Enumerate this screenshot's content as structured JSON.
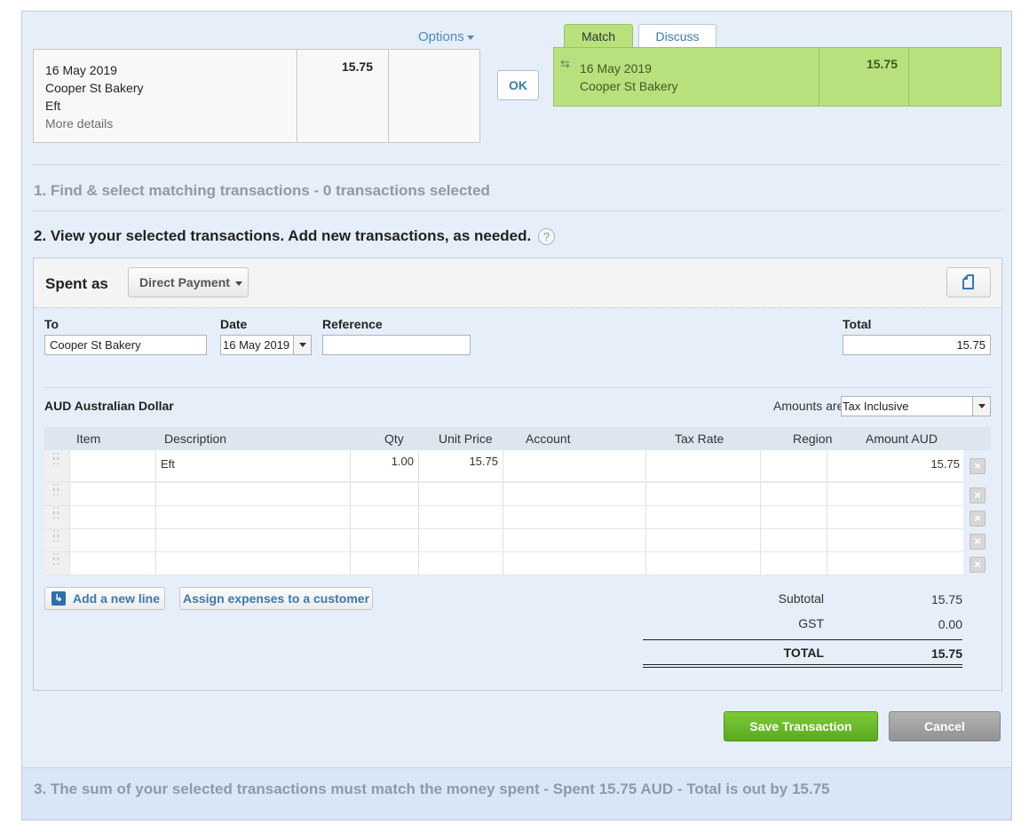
{
  "statement": {
    "options_label": "Options",
    "date": "16 May 2019",
    "payee": "Cooper St Bakery",
    "reference": "Eft",
    "more_details": "More details",
    "spent": "15.75",
    "received": ""
  },
  "ok_label": "OK",
  "tabs": [
    {
      "label": "Match"
    },
    {
      "label": "Discuss"
    }
  ],
  "match_card": {
    "date": "16 May 2019",
    "payee": "Cooper St Bakery",
    "spent": "15.75"
  },
  "steps": {
    "step1": "1. Find & select matching transactions - 0 transactions selected",
    "step2": "2. View your selected transactions. Add new transactions, as needed.",
    "step3": "3. The sum of your selected transactions must match the money spent - Spent 15.75 AUD - Total is out by 15.75"
  },
  "help_glyph": "?",
  "form": {
    "spent_as_label": "Spent as",
    "spent_as_value": "Direct Payment",
    "to_label": "To",
    "to_value": "Cooper St Bakery",
    "date_label": "Date",
    "date_value": "16 May 2019",
    "reference_label": "Reference",
    "reference_value": "",
    "total_label": "Total",
    "total_value": "15.75",
    "currency": "AUD Australian Dollar",
    "amounts_are_label": "Amounts are",
    "amounts_are_value": "Tax Inclusive"
  },
  "table": {
    "columns": [
      "Item",
      "Description",
      "Qty",
      "Unit Price",
      "Account",
      "Tax Rate",
      "Region",
      "Amount AUD"
    ],
    "rows": [
      {
        "item": "",
        "description": "Eft",
        "qty": "1.00",
        "unit_price": "15.75",
        "account": "",
        "tax_rate": "",
        "region": "",
        "amount": "15.75"
      },
      {
        "item": "",
        "description": "",
        "qty": "",
        "unit_price": "",
        "account": "",
        "tax_rate": "",
        "region": "",
        "amount": ""
      },
      {
        "item": "",
        "description": "",
        "qty": "",
        "unit_price": "",
        "account": "",
        "tax_rate": "",
        "region": "",
        "amount": ""
      },
      {
        "item": "",
        "description": "",
        "qty": "",
        "unit_price": "",
        "account": "",
        "tax_rate": "",
        "region": "",
        "amount": ""
      },
      {
        "item": "",
        "description": "",
        "qty": "",
        "unit_price": "",
        "account": "",
        "tax_rate": "",
        "region": "",
        "amount": ""
      }
    ]
  },
  "actions": {
    "add_line": "Add a new line",
    "assign_expenses": "Assign expenses to a customer",
    "save": "Save Transaction",
    "cancel": "Cancel"
  },
  "totals": {
    "subtotal_label": "Subtotal",
    "subtotal": "15.75",
    "gst_label": "GST",
    "gst": "0.00",
    "total_label": "TOTAL",
    "total": "15.75"
  },
  "colors": {
    "match_green": "#b8e07d",
    "save_green": "#5aaa1f",
    "link_blue": "#3a78b5",
    "panel_bg": "#e6eef9"
  }
}
